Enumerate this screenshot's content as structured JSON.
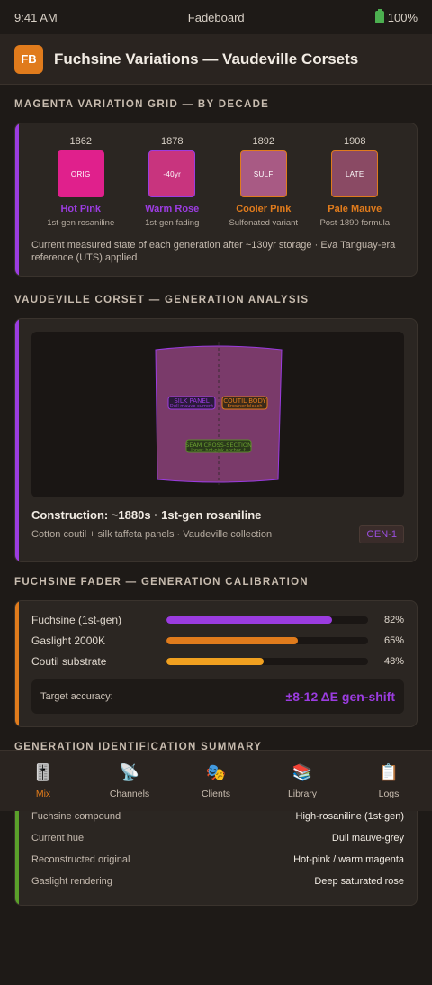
{
  "status": {
    "time": "9:41 AM",
    "app": "Fadeboard",
    "battery": "100%"
  },
  "header": {
    "logo": "FB",
    "title": "Fuchsine Variations — Vaudeville Corsets"
  },
  "grid": {
    "heading": "MAGENTA VARIATION GRID — BY DECADE",
    "swatches": [
      {
        "year": "1862",
        "chip": "ORIG",
        "name": "Hot Pink",
        "sub": "1st-gen rosaniline",
        "color": "#e0208c",
        "name_color": "#9b3ce0"
      },
      {
        "year": "1878",
        "chip": "-40yr",
        "name": "Warm Rose",
        "sub": "1st-gen fading",
        "color": "#c8347e",
        "name_color": "#9b3ce0"
      },
      {
        "year": "1892",
        "chip": "SULF",
        "name": "Cooler Pink",
        "sub": "Sulfonated variant",
        "color": "#a85a84",
        "name_color": "#e07b1c"
      },
      {
        "year": "1908",
        "chip": "LATE",
        "name": "Pale Mauve",
        "sub": "Post-1890 formula",
        "color": "#8a4a64",
        "name_color": "#e07b1c"
      }
    ],
    "note": "Current measured state of each generation after ~130yr storage · Eva Tanguay-era reference (UTS) applied"
  },
  "corset": {
    "heading": "VAUDEVILLE CORSET — GENERATION ANALYSIS",
    "silk_label": "SILK PANEL",
    "silk_sub": "Dull mauve current",
    "coutil_label": "COUTIL BODY",
    "coutil_sub": "Browner bleach",
    "seam_label": "SEAM CROSS-SECTION",
    "seam_sub": "Inner: hot-pink anchor ↑",
    "construction": "Construction: ~1880s · 1st-gen rosaniline",
    "sub": "Cotton coutil + silk taffeta panels · Vaudeville collection",
    "badge": "GEN-1"
  },
  "fader": {
    "heading": "FUCHSINE FADER — GENERATION CALIBRATION",
    "rows": [
      {
        "label": "Fuchsine (1st-gen)",
        "value": 82,
        "pct": "82%",
        "color": "#9b3ce0"
      },
      {
        "label": "Gaslight 2000K",
        "value": 65,
        "pct": "65%",
        "color": "#e07b1c"
      },
      {
        "label": "Coutil substrate",
        "value": 48,
        "pct": "48%",
        "color": "#f0a020"
      }
    ],
    "target_label": "Target accuracy:",
    "target_value": "±8-12 ΔE gen-shift"
  },
  "summary": {
    "heading": "GENERATION IDENTIFICATION SUMMARY",
    "rows": [
      {
        "k": "Fuchsine compound",
        "v": "High-rosaniline (1st-gen)"
      },
      {
        "k": "Current hue",
        "v": "Dull mauve-grey"
      },
      {
        "k": "Reconstructed original",
        "v": "Hot-pink / warm magenta"
      },
      {
        "k": "Gaslight rendering",
        "v": "Deep saturated rose"
      }
    ]
  },
  "tabs": [
    {
      "label": "Mix",
      "icon": "sliders-icon"
    },
    {
      "label": "Channels",
      "icon": "satellite-dish-icon"
    },
    {
      "label": "Clients",
      "icon": "theater-masks-icon"
    },
    {
      "label": "Library",
      "icon": "books-icon"
    },
    {
      "label": "Logs",
      "icon": "clipboard-icon"
    }
  ]
}
